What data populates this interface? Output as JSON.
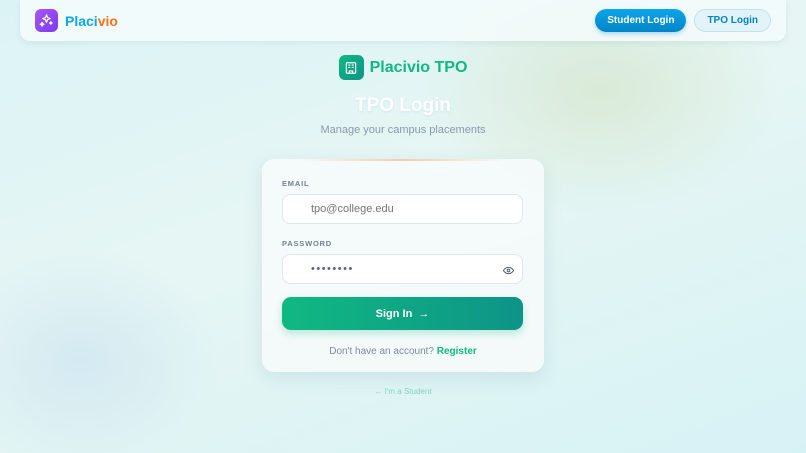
{
  "header": {
    "brand_a": "Placi",
    "brand_b": "vio",
    "student_login": "Student Login",
    "tpo_login": "TPO Login"
  },
  "hero": {
    "brand": "Placivio TPO",
    "title": "TPO Login",
    "subtitle": "Manage your campus placements"
  },
  "form": {
    "email_label": "EMAIL",
    "email_placeholder": "tpo@college.edu",
    "password_label": "PASSWORD",
    "password_value": "••••••••",
    "submit_label": "Sign In",
    "submit_arrow": "→",
    "register_prompt": "Don't have an account?",
    "register_link": "Register"
  },
  "footer": {
    "student_link": "← I'm a Student"
  },
  "colors": {
    "accent_green": "#10b981",
    "accent_blue": "#0ea5e9",
    "accent_orange": "#f97316",
    "brand_purple": "#a855f7"
  },
  "icons": {
    "brand": "sparkles-icon",
    "hero": "building-icon",
    "password_toggle": "eye-icon"
  }
}
